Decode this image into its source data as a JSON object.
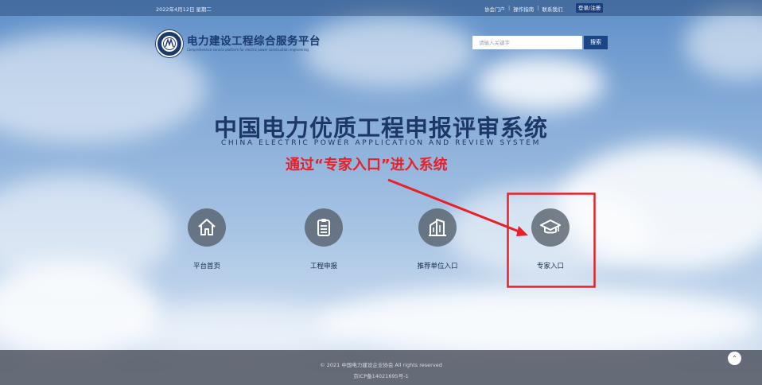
{
  "topbar": {
    "date": "2022年4月12日 星期二",
    "links": [
      "协会门户",
      "操作指南",
      "联系我们"
    ],
    "login_label": "登录/注册"
  },
  "logo": {
    "name_cn": "电力建设工程综合服务平台",
    "name_en": "Comprehensive service platform for electric power construction engineering"
  },
  "search": {
    "placeholder": "请输入关键字",
    "button_label": "搜索"
  },
  "hero": {
    "title_cn": "中国电力优质工程申报评审系统",
    "title_en": "CHINA ELECTRIC POWER APPLICATION AND REVIEW SYSTEM",
    "annotation": "通过“专家入口”进入系统"
  },
  "entries": [
    {
      "label": "平台首页",
      "icon": "home-icon"
    },
    {
      "label": "工程申报",
      "icon": "clipboard-icon"
    },
    {
      "label": "推荐单位入口",
      "icon": "building-icon"
    },
    {
      "label": "专家入口",
      "icon": "graduation-cap-icon"
    }
  ],
  "footer": {
    "copyright": "© 2021 中国电力建设企业协会 All rights reserved",
    "icp": "京ICP备14021695号-1"
  },
  "colors": {
    "brand": "#1a3a70",
    "highlight": "#e8202a",
    "button": "#1c4586"
  }
}
